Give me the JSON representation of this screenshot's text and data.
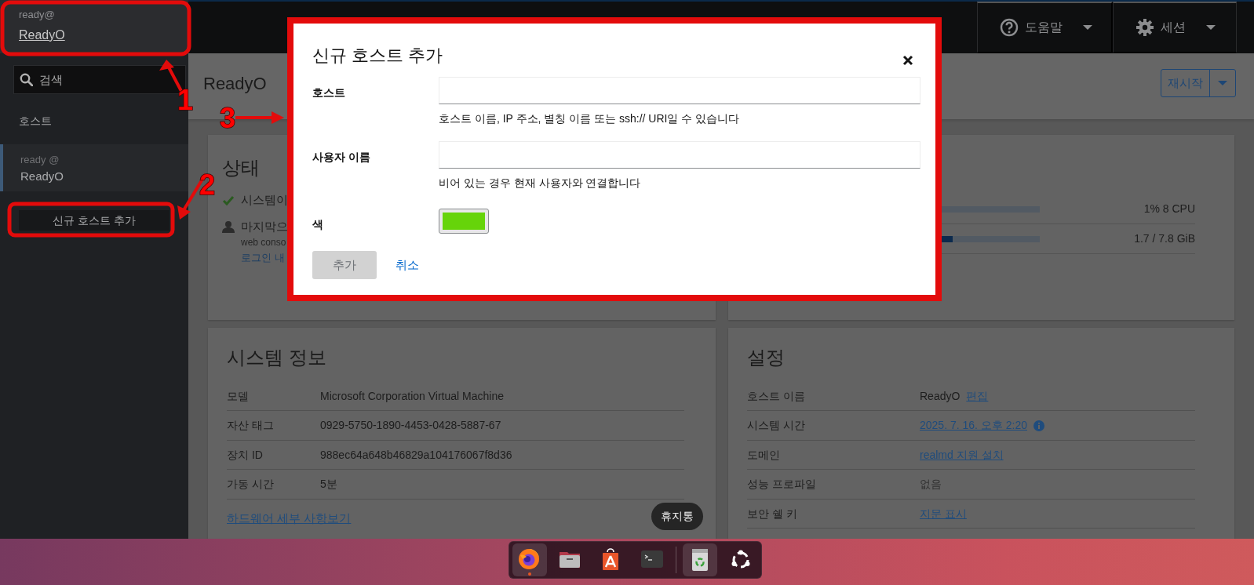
{
  "sidebar": {
    "current_host": {
      "user": "ready@",
      "name": "ReadyO"
    },
    "search": {
      "placeholder": "검색"
    },
    "section_title": "호스트",
    "hosts": [
      {
        "user": "ready @",
        "name": "ReadyO",
        "selected": true
      }
    ],
    "add_button": "신규 호스트 추가"
  },
  "header": {
    "menus": [
      {
        "kind": "help",
        "label": "도움말"
      },
      {
        "kind": "session",
        "label": "세션"
      }
    ]
  },
  "page": {
    "title": "ReadyO",
    "restart_button": "재시작"
  },
  "status_card": {
    "title": "상태",
    "items": [
      {
        "kind": "check",
        "text": "시스템이"
      },
      {
        "kind": "user",
        "text": "마지막으",
        "detail": "web conso",
        "link": "로그인 내"
      }
    ]
  },
  "usage_card": {
    "meters": [
      {
        "level": 0.01,
        "reading": "1% 8 CPU"
      },
      {
        "level": 0.22,
        "reading": "1.7 / 7.8 GiB"
      }
    ]
  },
  "system_info": {
    "title": "시스템 정보",
    "rows": [
      {
        "label": "모델",
        "value": "Microsoft Corporation Virtual Machine"
      },
      {
        "label": "자산 태그",
        "value": "0929-5750-1890-4453-0428-5887-67"
      },
      {
        "label": "장치 ID",
        "value": "988ec64a648b46829a104176067f8d36"
      },
      {
        "label": "가동 시간",
        "value": "5분"
      }
    ],
    "link": "하드웨어 세부 사항보기"
  },
  "settings": {
    "title": "설정",
    "rows": [
      {
        "label": "호스트 이름",
        "value": "ReadyO",
        "link": "편집",
        "info": false
      },
      {
        "label": "시스템 시간",
        "link": "2025. 7. 16. 오후 2:20",
        "info": true
      },
      {
        "label": "도메인",
        "link": "realmd 지원 설치",
        "info": false
      },
      {
        "label": "성능 프로파일",
        "value": "없음",
        "info": false
      },
      {
        "label": "보안 쉘 키",
        "link": "지문 표시",
        "info": false
      }
    ]
  },
  "dialog": {
    "title": "신규 호스트 추가",
    "fields": [
      {
        "kind": "text",
        "label": "호스트",
        "help": "호스트 이름, IP 주소, 별칭 이름 또는 ssh:// URI일 수 있습니다"
      },
      {
        "kind": "text",
        "label": "사용자 이름",
        "help": "비어 있는 경우 현재 사용자와 연결합니다"
      },
      {
        "kind": "color",
        "label": "색",
        "color": "#66d40a"
      }
    ],
    "buttons": [
      {
        "kind": "primary",
        "label": "추가",
        "disabled": true
      },
      {
        "kind": "link",
        "label": "취소",
        "disabled": false
      }
    ]
  },
  "dock": {
    "tooltip": "휴지통",
    "apps": [
      {
        "kind": "firefox",
        "running": true,
        "highlighted": true
      },
      {
        "kind": "files",
        "running": false,
        "highlighted": false
      },
      {
        "kind": "appcenter",
        "running": false,
        "highlighted": false
      },
      {
        "kind": "terminal",
        "running": false,
        "highlighted": false
      },
      {
        "kind": "separator"
      },
      {
        "kind": "trash",
        "running": false,
        "highlighted": true
      },
      {
        "kind": "ubuntu",
        "running": false,
        "highlighted": false
      }
    ]
  },
  "annotations": [
    {
      "label": "1"
    },
    {
      "label": "2"
    },
    {
      "label": "3"
    }
  ]
}
